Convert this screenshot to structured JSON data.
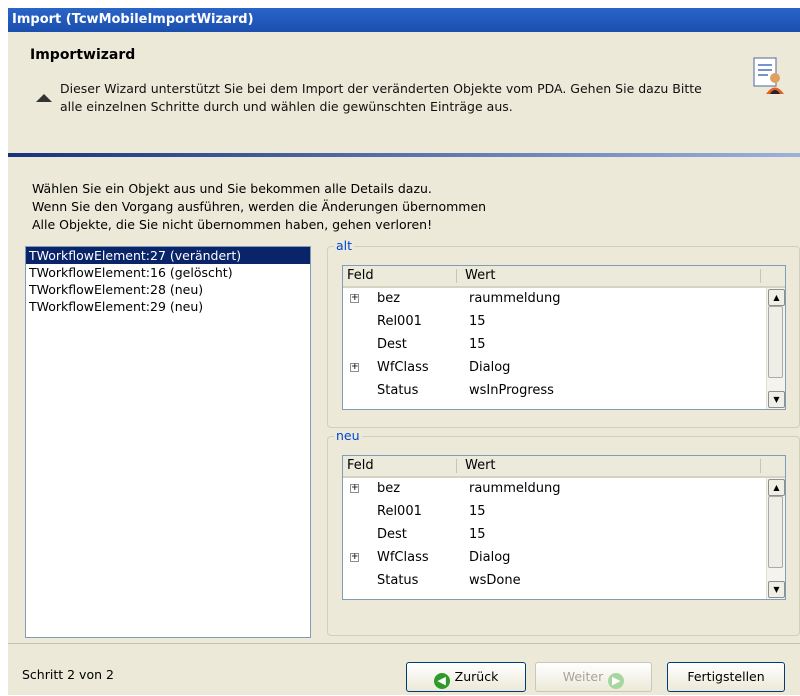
{
  "window": {
    "title": "Import (TcwMobileImportWizard)"
  },
  "header": {
    "title": "Importwizard",
    "description": "Dieser Wizard unterstützt Sie bei dem Import der veränderten Objekte vom PDA. Gehen Sie dazu Bitte alle einzelnen Schritte durch und wählen die gewünschten Einträge aus.",
    "icon": "document-user-icon"
  },
  "intro": [
    "Wählen Sie ein Objekt aus und Sie bekommen alle Details dazu.",
    "Wenn Sie den Vorgang ausführen, werden die Änderungen übernommen",
    "Alle Objekte, die Sie nicht übernommen haben, gehen verloren!"
  ],
  "objects": [
    {
      "label": "TWorkflowElement:27 (verändert)",
      "selected": true
    },
    {
      "label": "TWorkflowElement:16 (gelöscht)",
      "selected": false
    },
    {
      "label": "TWorkflowElement:28 (neu)",
      "selected": false
    },
    {
      "label": "TWorkflowElement:29 (neu)",
      "selected": false
    }
  ],
  "alt": {
    "legend": "alt",
    "columns": [
      "Feld",
      "Wert"
    ],
    "rows": [
      {
        "expand": true,
        "field": "bez",
        "value": "raummeldung"
      },
      {
        "expand": false,
        "field": "Rel001",
        "value": "15"
      },
      {
        "expand": false,
        "field": "Dest",
        "value": "15"
      },
      {
        "expand": true,
        "field": "WfClass",
        "value": "Dialog"
      },
      {
        "expand": false,
        "field": "Status",
        "value": "wsInProgress"
      }
    ]
  },
  "neu": {
    "legend": "neu",
    "columns": [
      "Feld",
      "Wert"
    ],
    "rows": [
      {
        "expand": true,
        "field": "bez",
        "value": "raummeldung"
      },
      {
        "expand": false,
        "field": "Rel001",
        "value": "15"
      },
      {
        "expand": false,
        "field": "Dest",
        "value": "15"
      },
      {
        "expand": true,
        "field": "WfClass",
        "value": "Dialog"
      },
      {
        "expand": false,
        "field": "Status",
        "value": "wsDone"
      }
    ]
  },
  "footer": {
    "step": "Schritt 2 von 2",
    "back": "Zurück",
    "next": "Weiter",
    "finish": "Fertigstellen"
  },
  "colors": {
    "titlebar": "#1b4fae",
    "selection": "#0a246a",
    "legend": "#0046d5",
    "nav_icon": "#2e9a2b"
  }
}
